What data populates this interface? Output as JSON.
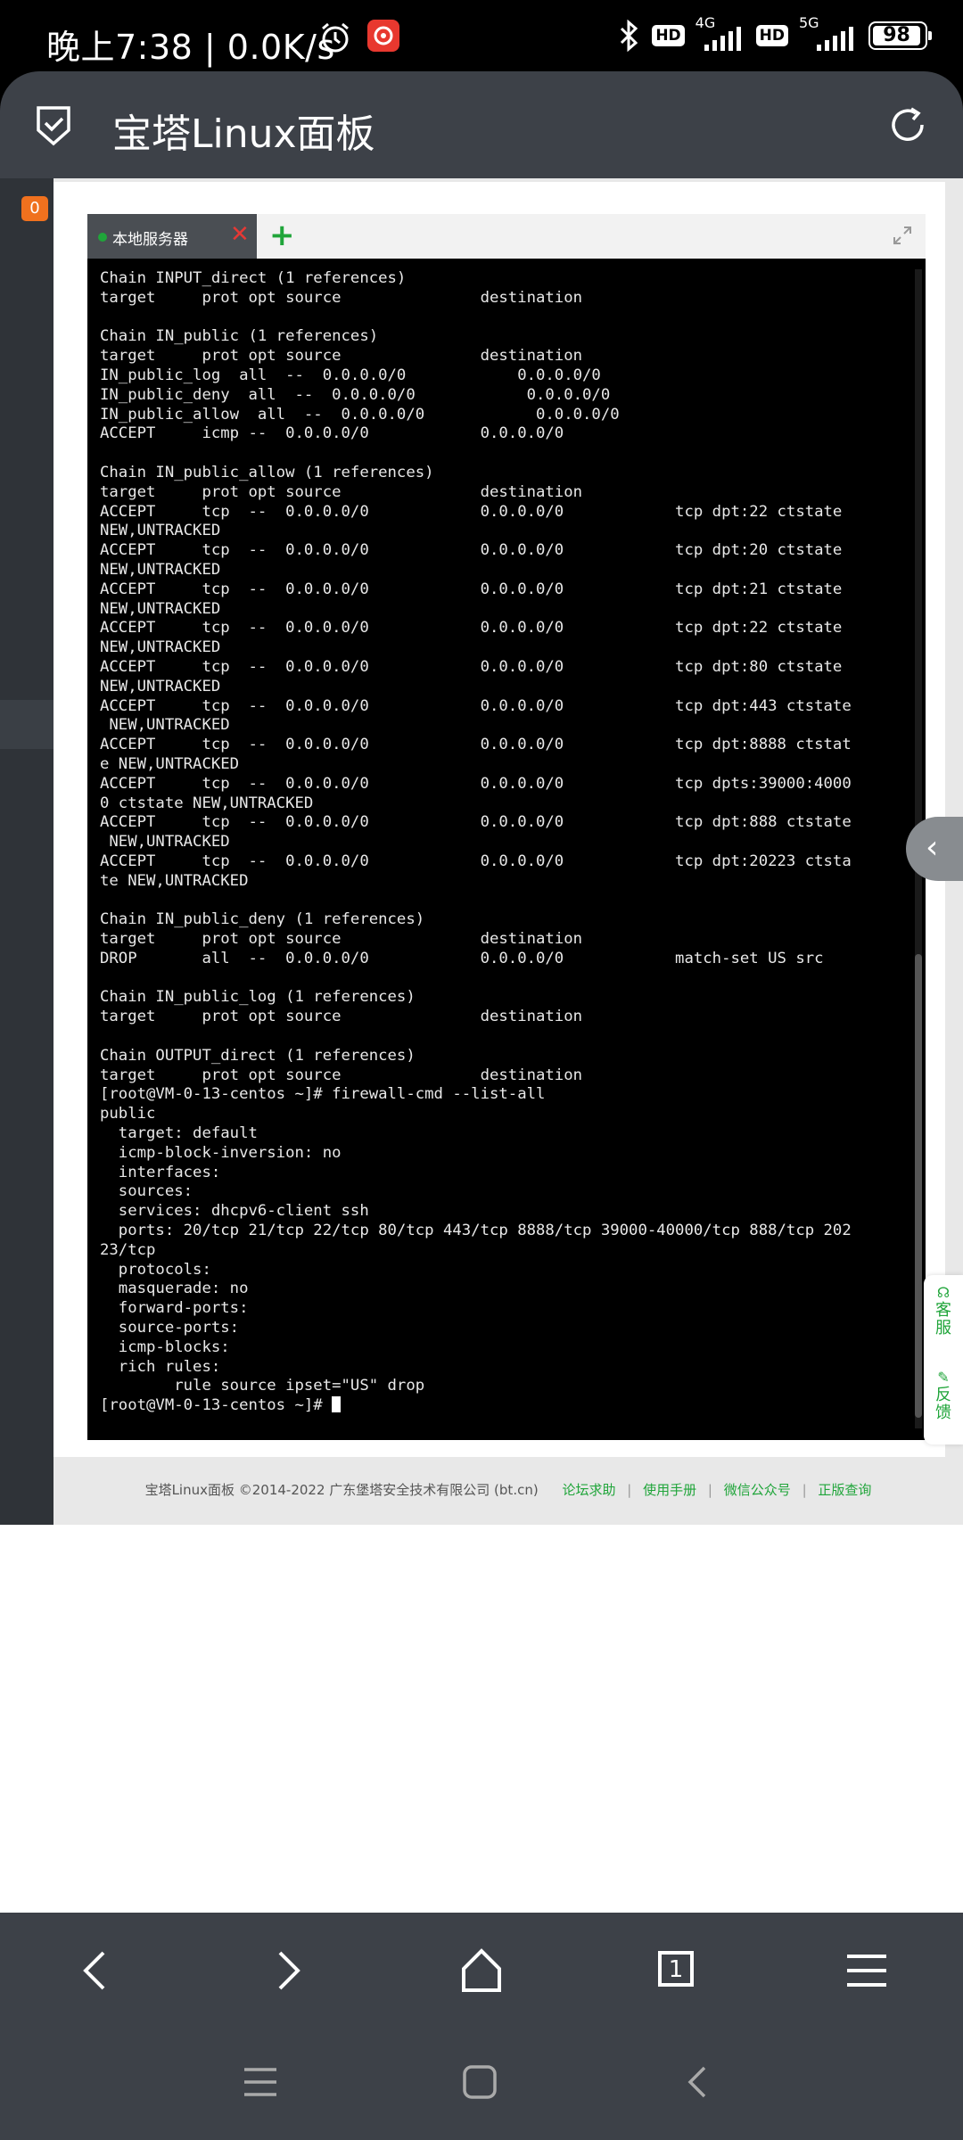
{
  "status_bar": {
    "time_speed": "晚上7:38 | 0.0K/s",
    "network_4g": "4G",
    "network_5g": "5G",
    "hd1": "HD",
    "hd2": "HD",
    "battery": "98"
  },
  "app_header": {
    "title": "宝塔Linux面板"
  },
  "sidebar": {
    "badge": "0"
  },
  "terminal": {
    "tab_label": "本地服务器",
    "tab_close": "✕",
    "tab_add": "+",
    "lines": [
      "Chain INPUT_direct (1 references)",
      "target     prot opt source               destination",
      "",
      "Chain IN_public (1 references)",
      "target     prot opt source               destination",
      "IN_public_log  all  --  0.0.0.0/0            0.0.0.0/0",
      "IN_public_deny  all  --  0.0.0.0/0            0.0.0.0/0",
      "IN_public_allow  all  --  0.0.0.0/0            0.0.0.0/0",
      "ACCEPT     icmp --  0.0.0.0/0            0.0.0.0/0",
      "",
      "Chain IN_public_allow (1 references)",
      "target     prot opt source               destination",
      "ACCEPT     tcp  --  0.0.0.0/0            0.0.0.0/0            tcp dpt:22 ctstate",
      "NEW,UNTRACKED",
      "ACCEPT     tcp  --  0.0.0.0/0            0.0.0.0/0            tcp dpt:20 ctstate",
      "NEW,UNTRACKED",
      "ACCEPT     tcp  --  0.0.0.0/0            0.0.0.0/0            tcp dpt:21 ctstate",
      "NEW,UNTRACKED",
      "ACCEPT     tcp  --  0.0.0.0/0            0.0.0.0/0            tcp dpt:22 ctstate",
      "NEW,UNTRACKED",
      "ACCEPT     tcp  --  0.0.0.0/0            0.0.0.0/0            tcp dpt:80 ctstate",
      "NEW,UNTRACKED",
      "ACCEPT     tcp  --  0.0.0.0/0            0.0.0.0/0            tcp dpt:443 ctstate",
      " NEW,UNTRACKED",
      "ACCEPT     tcp  --  0.0.0.0/0            0.0.0.0/0            tcp dpt:8888 ctstat",
      "e NEW,UNTRACKED",
      "ACCEPT     tcp  --  0.0.0.0/0            0.0.0.0/0            tcp dpts:39000:4000",
      "0 ctstate NEW,UNTRACKED",
      "ACCEPT     tcp  --  0.0.0.0/0            0.0.0.0/0            tcp dpt:888 ctstate",
      " NEW,UNTRACKED",
      "ACCEPT     tcp  --  0.0.0.0/0            0.0.0.0/0            tcp dpt:20223 ctsta",
      "te NEW,UNTRACKED",
      "",
      "Chain IN_public_deny (1 references)",
      "target     prot opt source               destination",
      "DROP       all  --  0.0.0.0/0            0.0.0.0/0            match-set US src",
      "",
      "Chain IN_public_log (1 references)",
      "target     prot opt source               destination",
      "",
      "Chain OUTPUT_direct (1 references)",
      "target     prot opt source               destination",
      "[root@VM-0-13-centos ~]# firewall-cmd --list-all",
      "public",
      "  target: default",
      "  icmp-block-inversion: no",
      "  interfaces:",
      "  sources:",
      "  services: dhcpv6-client ssh",
      "  ports: 20/tcp 21/tcp 22/tcp 80/tcp 443/tcp 8888/tcp 39000-40000/tcp 888/tcp 202",
      "23/tcp",
      "  protocols:",
      "  masquerade: no",
      "  forward-ports:",
      "  source-ports:",
      "  icmp-blocks:",
      "  rich rules:",
      "        rule source ipset=\"US\" drop"
    ],
    "prompt": "[root@VM-0-13-centos ~]# "
  },
  "side_panel": {
    "service": "客服",
    "feedback": "反馈"
  },
  "footer": {
    "copyright": "宝塔Linux面板 ©2014-2022 广东堡塔安全技术有限公司 (bt.cn)",
    "links": [
      "论坛求助",
      "使用手册",
      "微信公众号",
      "正版查询"
    ]
  },
  "browser_nav": {
    "tab_count": "1"
  }
}
